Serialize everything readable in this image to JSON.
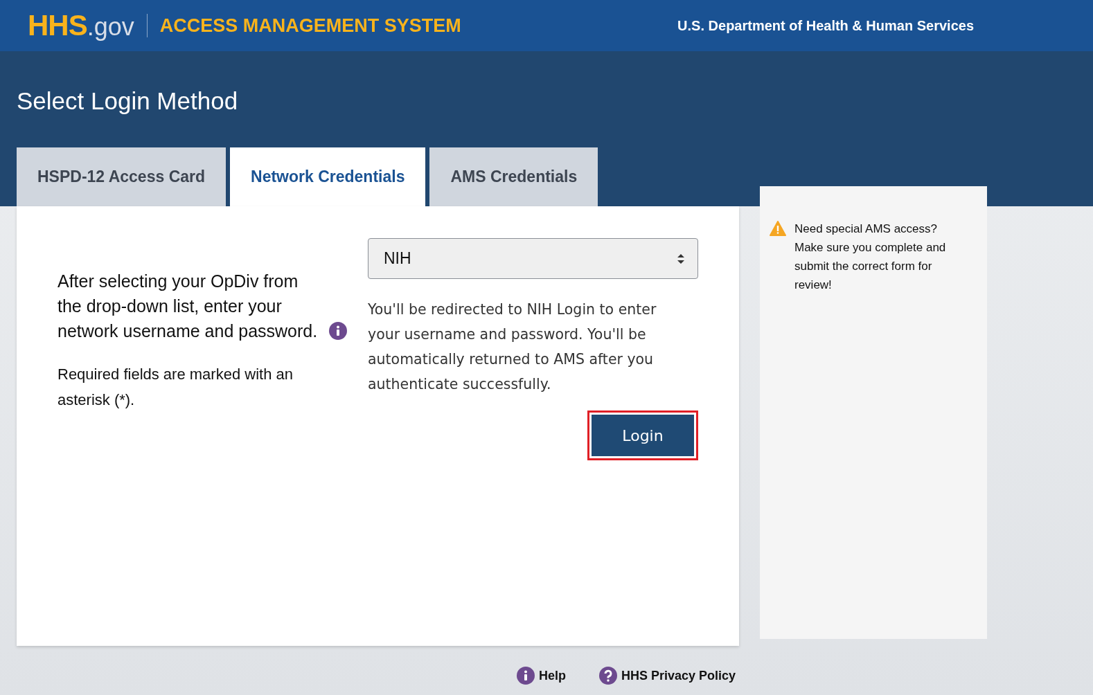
{
  "header": {
    "logo_main": "HHS",
    "logo_suffix": ".gov",
    "system_name": "ACCESS MANAGEMENT SYSTEM",
    "department": "U.S. Department of Health & Human Services"
  },
  "page_title": "Select Login Method",
  "tabs": [
    {
      "label": "HSPD-12 Access Card",
      "selected": false
    },
    {
      "label": "Network Credentials",
      "selected": true
    },
    {
      "label": "AMS Credentials",
      "selected": false
    }
  ],
  "panel": {
    "instructions": "After selecting your OpDiv from the drop-down list, enter your network username and password.",
    "required_note": "Required fields are marked with an asterisk (*).",
    "opdiv_select": {
      "value": "NIH"
    },
    "redirect_note": "You'll be redirected to NIH Login to enter your username and password. You'll be automatically returned to AMS after you authenticate successfully.",
    "login_button": "Login"
  },
  "sidebar": {
    "notice": "Need special AMS access? Make sure you complete and submit the correct form for review!"
  },
  "footer": {
    "links": [
      {
        "label": "Help",
        "kind": "info"
      },
      {
        "label": "HHS Privacy Policy",
        "kind": "question"
      }
    ]
  }
}
